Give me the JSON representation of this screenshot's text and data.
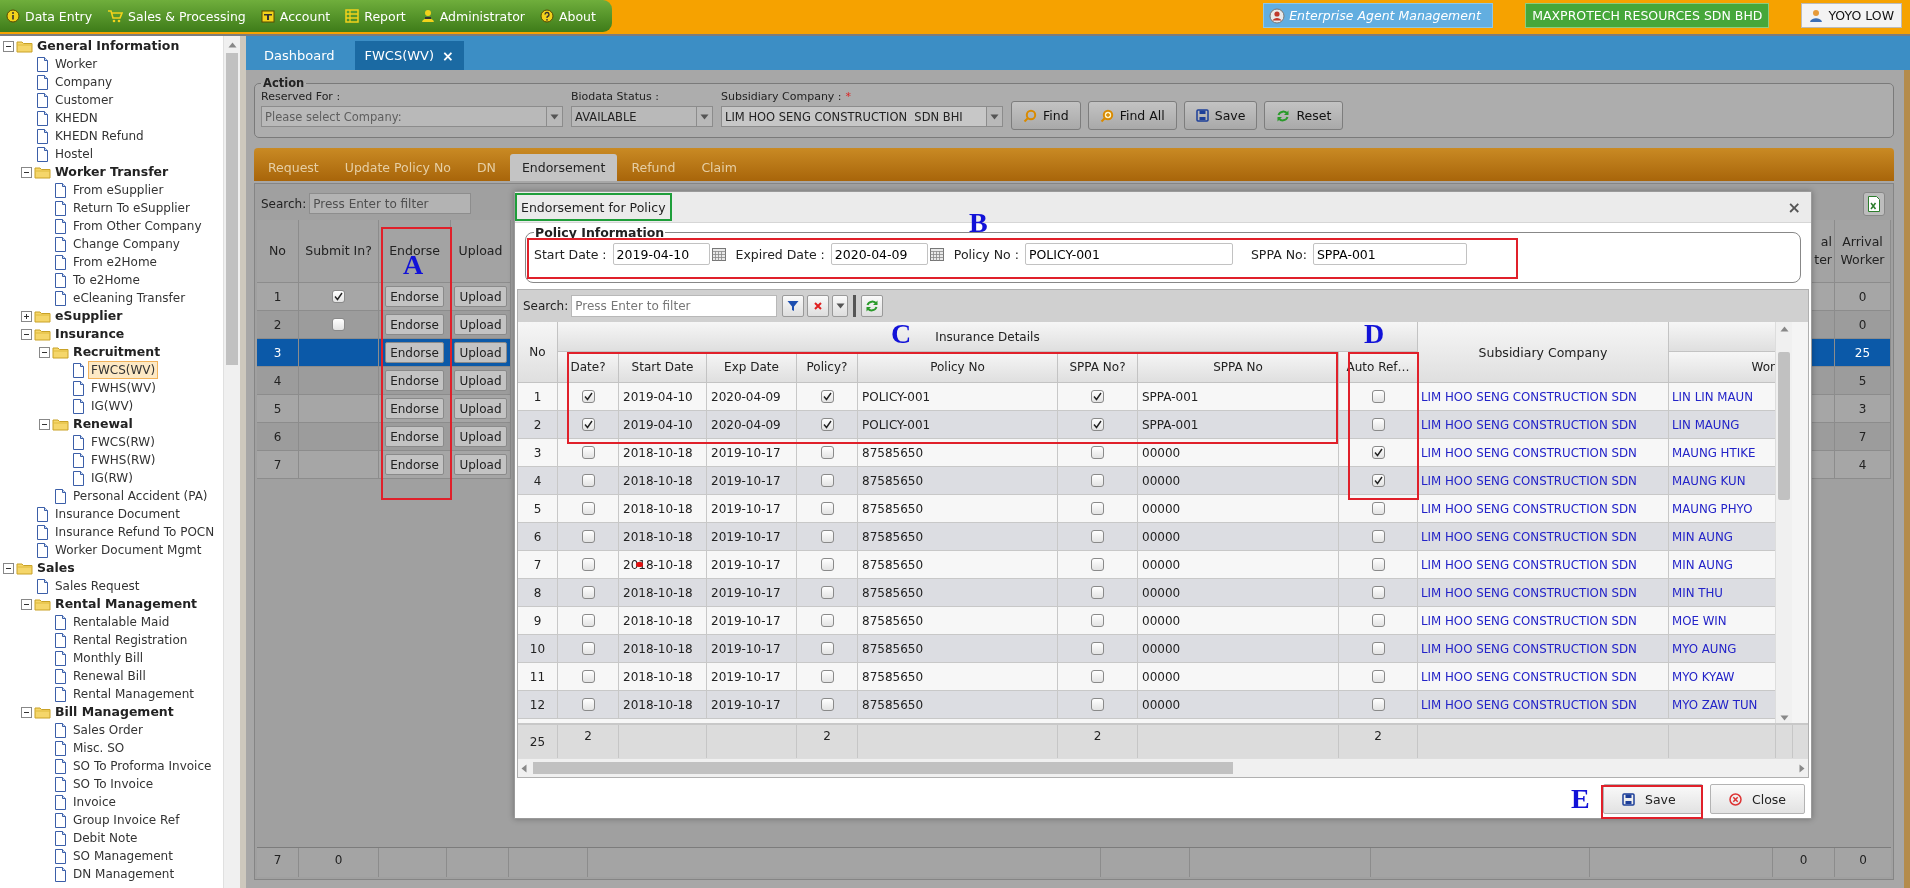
{
  "menu": [
    {
      "label": "Data Entry"
    },
    {
      "label": "Sales & Processing"
    },
    {
      "label": "Account"
    },
    {
      "label": "Report"
    },
    {
      "label": "Administrator"
    },
    {
      "label": "About"
    }
  ],
  "header_right": {
    "agent_button": "Enterprise Agent Management",
    "company": "MAXPROTECH RESOURCES SDN BHD",
    "user": "YOYO LOW"
  },
  "sidebar": {
    "items": [
      {
        "label": "General Information",
        "kind": "folder",
        "expanded": true,
        "selected": false,
        "children": [
          {
            "label": "Worker",
            "kind": "doc",
            "selected": false
          },
          {
            "label": "Company",
            "kind": "doc",
            "selected": false
          },
          {
            "label": "Customer",
            "kind": "doc",
            "selected": false
          },
          {
            "label": "KHEDN",
            "kind": "doc",
            "selected": false
          },
          {
            "label": "KHEDN Refund",
            "kind": "doc",
            "selected": false
          },
          {
            "label": "Hostel",
            "kind": "doc",
            "selected": false
          },
          {
            "label": "Worker Transfer",
            "kind": "folder",
            "expanded": true,
            "selected": false,
            "children": [
              {
                "label": "From eSupplier",
                "kind": "doc",
                "selected": false
              },
              {
                "label": "Return To eSupplier",
                "kind": "doc",
                "selected": false
              },
              {
                "label": "From Other Company",
                "kind": "doc",
                "selected": false
              },
              {
                "label": "Change Company",
                "kind": "doc",
                "selected": false
              },
              {
                "label": "From e2Home",
                "kind": "doc",
                "selected": false
              },
              {
                "label": "To e2Home",
                "kind": "doc",
                "selected": false
              },
              {
                "label": "eCleaning Transfer",
                "kind": "doc",
                "selected": false
              }
            ]
          },
          {
            "label": "eSupplier",
            "kind": "folder",
            "expanded": false,
            "selected": false
          },
          {
            "label": "Insurance",
            "kind": "folder",
            "expanded": true,
            "selected": false,
            "children": [
              {
                "label": "Recruitment",
                "kind": "folder",
                "expanded": true,
                "selected": false,
                "children": [
                  {
                    "label": "FWCS(WV)",
                    "kind": "doc",
                    "selected": true
                  },
                  {
                    "label": "FWHS(WV)",
                    "kind": "doc",
                    "selected": false
                  },
                  {
                    "label": "IG(WV)",
                    "kind": "doc",
                    "selected": false
                  }
                ]
              },
              {
                "label": "Renewal",
                "kind": "folder",
                "expanded": true,
                "selected": false,
                "children": [
                  {
                    "label": "FWCS(RW)",
                    "kind": "doc",
                    "selected": false
                  },
                  {
                    "label": "FWHS(RW)",
                    "kind": "doc",
                    "selected": false
                  },
                  {
                    "label": "IG(RW)",
                    "kind": "doc",
                    "selected": false
                  }
                ]
              },
              {
                "label": "Personal Accident (PA)",
                "kind": "doc",
                "selected": false
              }
            ]
          },
          {
            "label": "Insurance Document",
            "kind": "doc",
            "selected": false
          },
          {
            "label": "Insurance Refund To POCN",
            "kind": "doc",
            "selected": false
          },
          {
            "label": "Worker Document Mgmt",
            "kind": "doc",
            "selected": false
          }
        ]
      },
      {
        "label": "Sales",
        "kind": "folder",
        "expanded": true,
        "selected": false,
        "children": [
          {
            "label": "Sales Request",
            "kind": "doc",
            "selected": false
          },
          {
            "label": "Rental Management",
            "kind": "folder",
            "expanded": true,
            "selected": false,
            "children": [
              {
                "label": "Rentalable Maid",
                "kind": "doc",
                "selected": false
              },
              {
                "label": "Rental Registration",
                "kind": "doc",
                "selected": false
              },
              {
                "label": "Monthly Bill",
                "kind": "doc",
                "selected": false
              },
              {
                "label": "Renewal Bill",
                "kind": "doc",
                "selected": false
              },
              {
                "label": "Rental Management",
                "kind": "doc",
                "selected": false
              }
            ]
          },
          {
            "label": "Bill Management",
            "kind": "folder",
            "expanded": true,
            "selected": false,
            "children": [
              {
                "label": "Sales Order",
                "kind": "doc",
                "selected": false
              },
              {
                "label": "Misc. SO",
                "kind": "doc",
                "selected": false
              },
              {
                "label": "SO To Proforma Invoice",
                "kind": "doc",
                "selected": false
              },
              {
                "label": "SO To Invoice",
                "kind": "doc",
                "selected": false
              },
              {
                "label": "Invoice",
                "kind": "doc",
                "selected": false
              },
              {
                "label": "Group Invoice Ref",
                "kind": "doc",
                "selected": false
              },
              {
                "label": "Debit Note",
                "kind": "doc",
                "selected": false
              },
              {
                "label": "SO Management",
                "kind": "doc",
                "selected": false
              },
              {
                "label": "DN Management",
                "kind": "doc",
                "selected": false
              }
            ]
          }
        ]
      }
    ]
  },
  "page_tabs": [
    {
      "label": "Dashboard",
      "selected": false
    },
    {
      "label": "FWCS(WV)",
      "selected": true,
      "close": "×"
    }
  ],
  "action": {
    "legend": "Action",
    "fields": [
      {
        "label": "Reserved For :",
        "placeholder": "Please select Company:"
      },
      {
        "label": "Biodata Status :",
        "value": "AVAILABLE"
      },
      {
        "label": "Subsidiary Company :",
        "required_mark": "*",
        "value": "LIM HOO SENG CONSTRUCTION  SDN BHI"
      }
    ],
    "buttons": [
      {
        "label": "Find"
      },
      {
        "label": "Find All"
      },
      {
        "label": "Save"
      },
      {
        "label": "Reset"
      }
    ]
  },
  "sub_tabs": [
    {
      "label": "Request",
      "selected": false
    },
    {
      "label": "Update Policy No",
      "selected": false
    },
    {
      "label": "DN",
      "selected": false
    },
    {
      "label": "Endorsement",
      "selected": true
    },
    {
      "label": "Refund",
      "selected": false
    },
    {
      "label": "Claim",
      "selected": false
    }
  ],
  "grid": {
    "search_label": "Search:",
    "search_placeholder": "Press Enter to filter",
    "columns": [
      "No",
      "Submit In?",
      "Endorse",
      "Upload",
      "al\nter",
      "Arrival Worker"
    ],
    "rows": [
      {
        "no": "1",
        "submit_in": true,
        "endorse": "Endorse",
        "upload": "Upload",
        "arrival_worker": "0",
        "selected": false
      },
      {
        "no": "2",
        "submit_in": false,
        "endorse": "Endorse",
        "upload": "Upload",
        "arrival_worker": "0",
        "selected": false
      },
      {
        "no": "3",
        "endorse": "Endorse",
        "upload": "Upload",
        "arrival_worker": "25",
        "selected": true
      },
      {
        "no": "4",
        "endorse": "Endorse",
        "upload": "Upload",
        "arrival_worker": "5",
        "selected": false
      },
      {
        "no": "5",
        "endorse": "Endorse",
        "upload": "Upload",
        "arrival_worker": "3",
        "selected": false
      },
      {
        "no": "6",
        "endorse": "Endorse",
        "upload": "Upload",
        "arrival_worker": "7",
        "selected": false
      },
      {
        "no": "7",
        "endorse": "Endorse",
        "upload": "Upload",
        "arrival_worker": "4",
        "selected": false
      }
    ],
    "footer": {
      "no": "7",
      "submit_in": "0",
      "column_5": "0",
      "arrival_worker": "0"
    }
  },
  "modal": {
    "title": "Endorsement for Policy",
    "close": "×",
    "policy_info": {
      "legend": "Policy Information",
      "fields": [
        {
          "label": "Start Date :",
          "value": "2019-04-10",
          "kind": "date"
        },
        {
          "label": "Expired Date :",
          "value": "2020-04-09",
          "kind": "date"
        },
        {
          "label": "Policy No :",
          "value": "POLICY-001",
          "kind": "text"
        },
        {
          "label": "SPPA No:",
          "value": "SPPA-001",
          "kind": "text"
        }
      ]
    },
    "grid": {
      "search_label": "Search:",
      "search_placeholder": "Press Enter to filter",
      "group_header": "Insurance Details",
      "columns": [
        "No",
        "Date?",
        "Start Date",
        "Exp Date",
        "Policy?",
        "Policy No",
        "SPPA No?",
        "SPPA No",
        "Auto Ref…",
        "Subsidiary Company",
        "Wor"
      ],
      "rows": [
        {
          "no": "1",
          "date_checked": true,
          "start_date": "2019-04-10",
          "exp_date": "2020-04-09",
          "policy_checked": true,
          "policy_no": "POLICY-001",
          "sppa_checked": true,
          "sppa_no": "SPPA-001",
          "auto_refund_checked": false,
          "subsidiary_company": "LIM HOO SENG CONSTRUCTION SDN",
          "worker": "LIN LIN MAUN"
        },
        {
          "no": "2",
          "date_checked": true,
          "start_date": "2019-04-10",
          "exp_date": "2020-04-09",
          "policy_checked": true,
          "policy_no": "POLICY-001",
          "sppa_checked": true,
          "sppa_no": "SPPA-001",
          "auto_refund_checked": false,
          "subsidiary_company": "LIM HOO SENG CONSTRUCTION SDN",
          "worker": "LIN MAUNG"
        },
        {
          "no": "3",
          "date_checked": false,
          "start_date": "2018-10-18",
          "exp_date": "2019-10-17",
          "policy_checked": false,
          "policy_no": "87585650",
          "sppa_checked": false,
          "sppa_no": "00000",
          "auto_refund_checked": true,
          "subsidiary_company": "LIM HOO SENG CONSTRUCTION SDN",
          "worker": "MAUNG HTIKE"
        },
        {
          "no": "4",
          "date_checked": false,
          "start_date": "2018-10-18",
          "exp_date": "2019-10-17",
          "policy_checked": false,
          "policy_no": "87585650",
          "sppa_checked": false,
          "sppa_no": "00000",
          "auto_refund_checked": true,
          "subsidiary_company": "LIM HOO SENG CONSTRUCTION SDN",
          "worker": "MAUNG KUN"
        },
        {
          "no": "5",
          "date_checked": false,
          "start_date": "2018-10-18",
          "exp_date": "2019-10-17",
          "policy_checked": false,
          "policy_no": "87585650",
          "sppa_checked": false,
          "sppa_no": "00000",
          "auto_refund_checked": false,
          "subsidiary_company": "LIM HOO SENG CONSTRUCTION SDN",
          "worker": "MAUNG PHYO"
        },
        {
          "no": "6",
          "date_checked": false,
          "start_date": "2018-10-18",
          "exp_date": "2019-10-17",
          "policy_checked": false,
          "policy_no": "87585650",
          "sppa_checked": false,
          "sppa_no": "00000",
          "auto_refund_checked": false,
          "subsidiary_company": "LIM HOO SENG CONSTRUCTION SDN",
          "worker": "MIN AUNG"
        },
        {
          "no": "7",
          "date_checked": false,
          "start_date": "2018-10-18",
          "exp_date": "2019-10-17",
          "policy_checked": false,
          "policy_no": "87585650",
          "sppa_checked": false,
          "sppa_no": "00000",
          "auto_refund_checked": false,
          "subsidiary_company": "LIM HOO SENG CONSTRUCTION SDN",
          "worker": "MIN AUNG",
          "marker": true
        },
        {
          "no": "8",
          "date_checked": false,
          "start_date": "2018-10-18",
          "exp_date": "2019-10-17",
          "policy_checked": false,
          "policy_no": "87585650",
          "sppa_checked": false,
          "sppa_no": "00000",
          "auto_refund_checked": false,
          "subsidiary_company": "LIM HOO SENG CONSTRUCTION SDN",
          "worker": "MIN THU"
        },
        {
          "no": "9",
          "date_checked": false,
          "start_date": "2018-10-18",
          "exp_date": "2019-10-17",
          "policy_checked": false,
          "policy_no": "87585650",
          "sppa_checked": false,
          "sppa_no": "00000",
          "auto_refund_checked": false,
          "subsidiary_company": "LIM HOO SENG CONSTRUCTION SDN",
          "worker": "MOE WIN"
        },
        {
          "no": "10",
          "date_checked": false,
          "start_date": "2018-10-18",
          "exp_date": "2019-10-17",
          "policy_checked": false,
          "policy_no": "87585650",
          "sppa_checked": false,
          "sppa_no": "00000",
          "auto_refund_checked": false,
          "subsidiary_company": "LIM HOO SENG CONSTRUCTION SDN",
          "worker": "MYO AUNG"
        },
        {
          "no": "11",
          "date_checked": false,
          "start_date": "2018-10-18",
          "exp_date": "2019-10-17",
          "policy_checked": false,
          "policy_no": "87585650",
          "sppa_checked": false,
          "sppa_no": "00000",
          "auto_refund_checked": false,
          "subsidiary_company": "LIM HOO SENG CONSTRUCTION SDN",
          "worker": "MYO KYAW"
        },
        {
          "no": "12",
          "date_checked": false,
          "start_date": "2018-10-18",
          "exp_date": "2019-10-17",
          "policy_checked": false,
          "policy_no": "87585650",
          "sppa_checked": false,
          "sppa_no": "00000",
          "auto_refund_checked": false,
          "subsidiary_company": "LIM HOO SENG CONSTRUCTION SDN",
          "worker": "MYO ZAW TUN"
        }
      ],
      "footer": {
        "no": "25",
        "date": "2",
        "policy": "2",
        "sppa": "2",
        "auto_refund": "2"
      }
    },
    "buttons": [
      {
        "label": "Save"
      },
      {
        "label": "Close"
      }
    ]
  },
  "annotations": [
    {
      "label": "A",
      "kind": "endorse-column"
    },
    {
      "label": "B",
      "kind": "policy-fields"
    },
    {
      "label": "C",
      "kind": "insurance-rows"
    },
    {
      "label": "D",
      "kind": "auto-refund-column"
    },
    {
      "label": "E",
      "kind": "save-button"
    }
  ]
}
